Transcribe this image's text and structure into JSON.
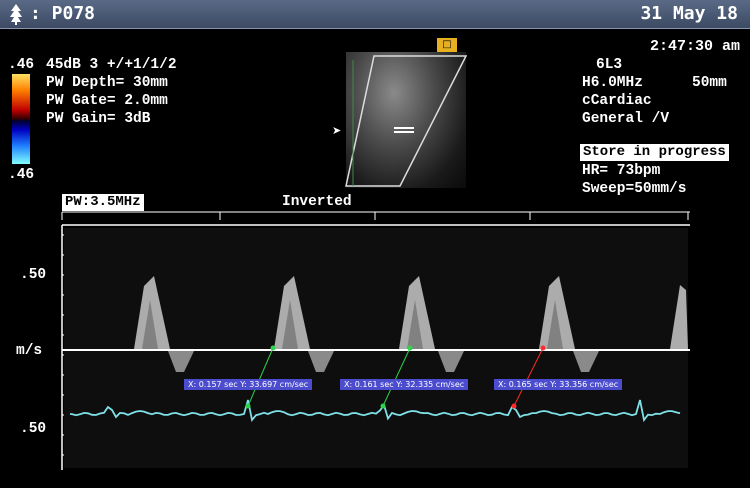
{
  "header": {
    "patient_id": ": P078",
    "date": "31 May 18",
    "time": "2:47:30 am"
  },
  "colorbar": {
    "top_label": ".46",
    "bottom_label": ".46"
  },
  "params": {
    "line1": "45dB  3 +/+1/1/2",
    "line2": "PW Depth= 30mm",
    "line3": "PW Gate= 2.0mm",
    "line4": "PW Gain=    3dB"
  },
  "probe": {
    "transducer": "6L3",
    "frequency": "H6.0MHz",
    "depth": "50mm",
    "preset": "cCardiac",
    "application": "General /V"
  },
  "status": {
    "store": "Store in progress",
    "hr": "HR= 73bpm",
    "sweep": "Sweep=50mm/s"
  },
  "doppler": {
    "pw_freq": "PW:3.5MHz",
    "inverted": "Inverted",
    "scale_top": ".50",
    "unit": "m/s",
    "scale_bottom": ".50"
  },
  "measurements": [
    "X: 0.157 sec Y: 33.697 cm/sec",
    "X: 0.161 sec Y: 32.335 cm/sec",
    "X: 0.165 sec Y: 33.356 cm/sec"
  ],
  "colors": {
    "ecg": "#7fe0e8",
    "marker_green": "#2bd44a",
    "marker_red": "#ff2a2a",
    "measure_bg": "#4c4ccf"
  }
}
